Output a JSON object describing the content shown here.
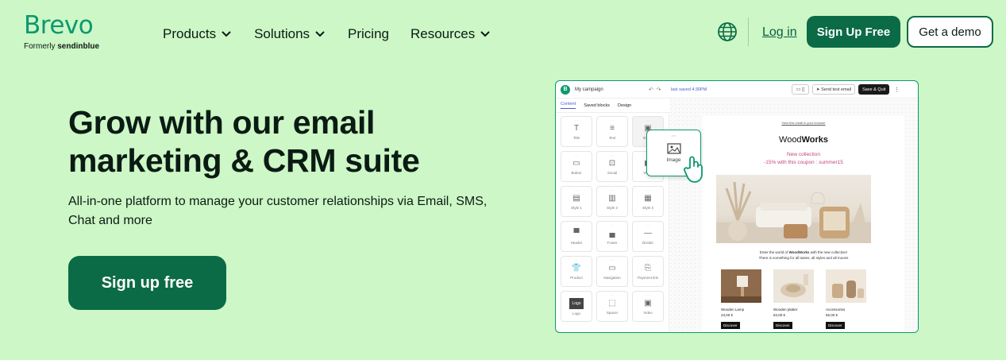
{
  "brand": {
    "name": "Brevo",
    "formerly_prefix": "Formerly",
    "formerly_name": "sendinblue"
  },
  "nav": {
    "items": [
      {
        "label": "Products",
        "has_dropdown": true
      },
      {
        "label": "Solutions",
        "has_dropdown": true
      },
      {
        "label": "Pricing",
        "has_dropdown": false
      },
      {
        "label": "Resources",
        "has_dropdown": true
      }
    ],
    "icons": {
      "language": "globe-icon",
      "dropdown": "chevron-down-icon"
    }
  },
  "header_actions": {
    "login": "Log in",
    "signup": "Sign Up Free",
    "demo": "Get a demo"
  },
  "hero": {
    "title": "Grow with our email marketing & CRM suite",
    "subtitle": "All-in-one platform to manage your customer relationships via Email, SMS, Chat and more",
    "cta": "Sign up free"
  },
  "editor": {
    "logo_letter": "B",
    "campaign_name": "My campaign",
    "last_saved": "last saved 4:30PM",
    "send_test": "Send test email",
    "save_quit": "Save & Quit",
    "tabs": [
      "Content",
      "Saved blocks",
      "Design"
    ],
    "blocks": [
      "Title",
      "Text",
      "Image",
      "Button",
      "Social",
      "Video",
      "Style 1",
      "Style 2",
      "Style 3",
      "Header",
      "Footer",
      "Divider",
      "Product",
      "Navigation",
      "Payment link",
      "Logo",
      "Spacer",
      "Video"
    ],
    "drag_label": "Image",
    "email": {
      "view_browser": "View this email in your browser",
      "brand_light": "Wood",
      "brand_bold": "Works",
      "headline": "New collection",
      "coupon": "-15% with this coupon : summer15",
      "intro_pre": "Enter the world of ",
      "intro_brand": "WoodWorks",
      "intro_post": " with the new collection!",
      "intro_line2": "There is something for all tastes, all styles and all moons",
      "products": [
        {
          "name": "Wooden Lamp",
          "price": "23,00 €",
          "button": "Discover"
        },
        {
          "name": "Wooden platter",
          "price": "84,00 €",
          "button": "Discover"
        },
        {
          "name": "Accessories",
          "price": "55,00 €",
          "button": "Discover"
        }
      ]
    }
  },
  "colors": {
    "background": "#cdf7c6",
    "brand_green": "#0b996e",
    "button_green": "#0b6b47",
    "coupon_pink": "#c4457f"
  }
}
